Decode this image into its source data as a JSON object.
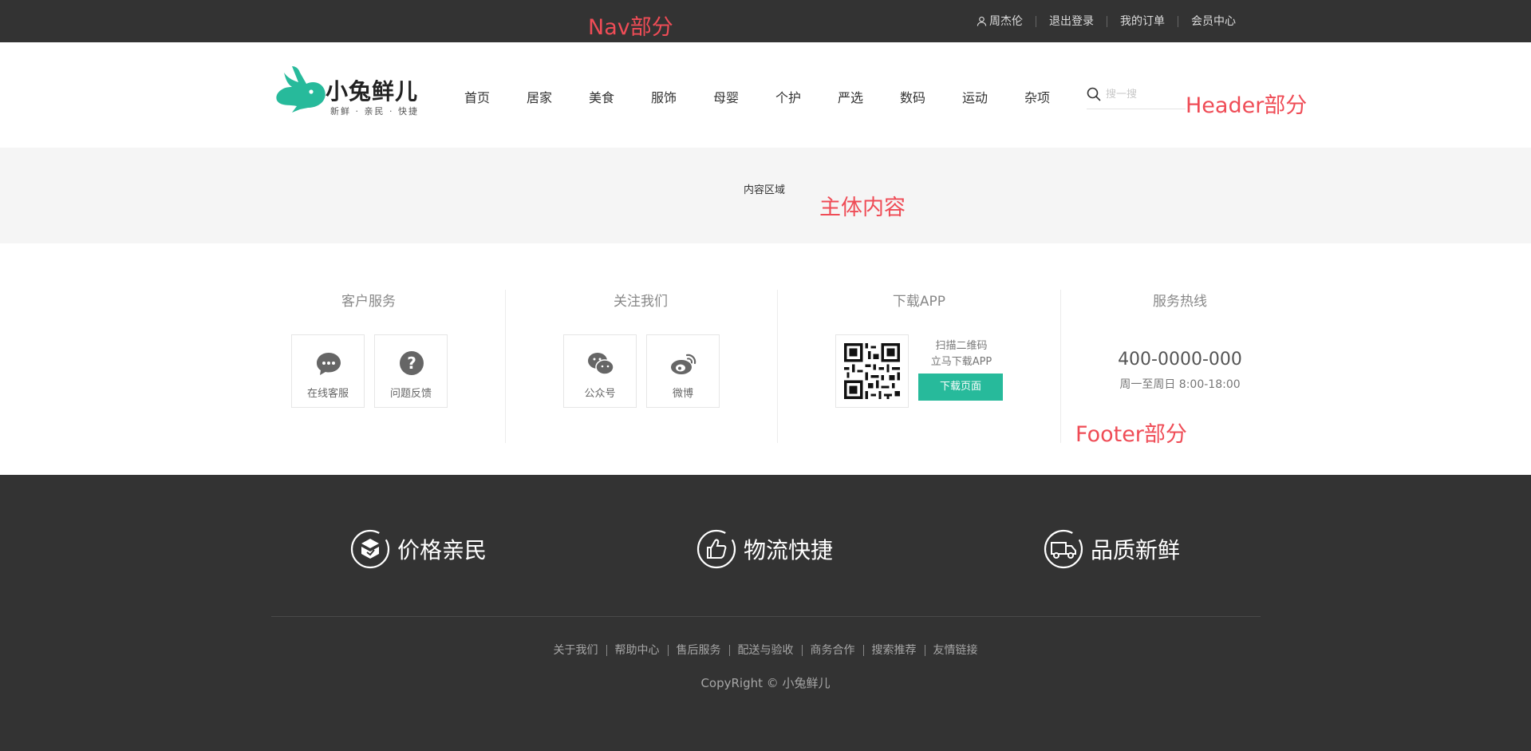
{
  "nav": {
    "label": "Nav部分",
    "links": [
      "周杰伦",
      "退出登录",
      "我的订单",
      "会员中心"
    ]
  },
  "header": {
    "label": "Header部分",
    "logo_text": "小兔鲜儿",
    "logo_sub": "新鲜 · 亲民 · 快捷",
    "menu": [
      "首页",
      "居家",
      "美食",
      "服饰",
      "母婴",
      "个护",
      "严选",
      "数码",
      "运动",
      "杂项"
    ],
    "search_placeholder": "搜一搜"
  },
  "content": {
    "title": "内容区域",
    "label": "主体内容"
  },
  "service": {
    "label": "Footer部分",
    "customer": {
      "heading": "客户服务",
      "tiles": [
        "在线客服",
        "问题反馈"
      ]
    },
    "follow": {
      "heading": "关注我们",
      "tiles": [
        "公众号",
        "微博"
      ]
    },
    "app": {
      "heading": "下载APP",
      "line1": "扫描二维码",
      "line2": "立马下载APP",
      "button": "下载页面"
    },
    "hotline": {
      "heading": "服务热线",
      "phone": "400-0000-000",
      "hours": "周一至周日 8:00-18:00"
    }
  },
  "bottom": {
    "features": [
      "价格亲民",
      "物流快捷",
      "品质新鲜"
    ],
    "links": [
      "关于我们",
      "帮助中心",
      "售后服务",
      "配送与验收",
      "商务合作",
      "搜索推荐",
      "友情链接"
    ],
    "copyright": "CopyRight © 小兔鲜儿"
  },
  "colors": {
    "nav_bg": "#333333",
    "brand": "#27ba9b",
    "annotation": "#ef4c56",
    "content_bg": "#f5f5f5"
  }
}
